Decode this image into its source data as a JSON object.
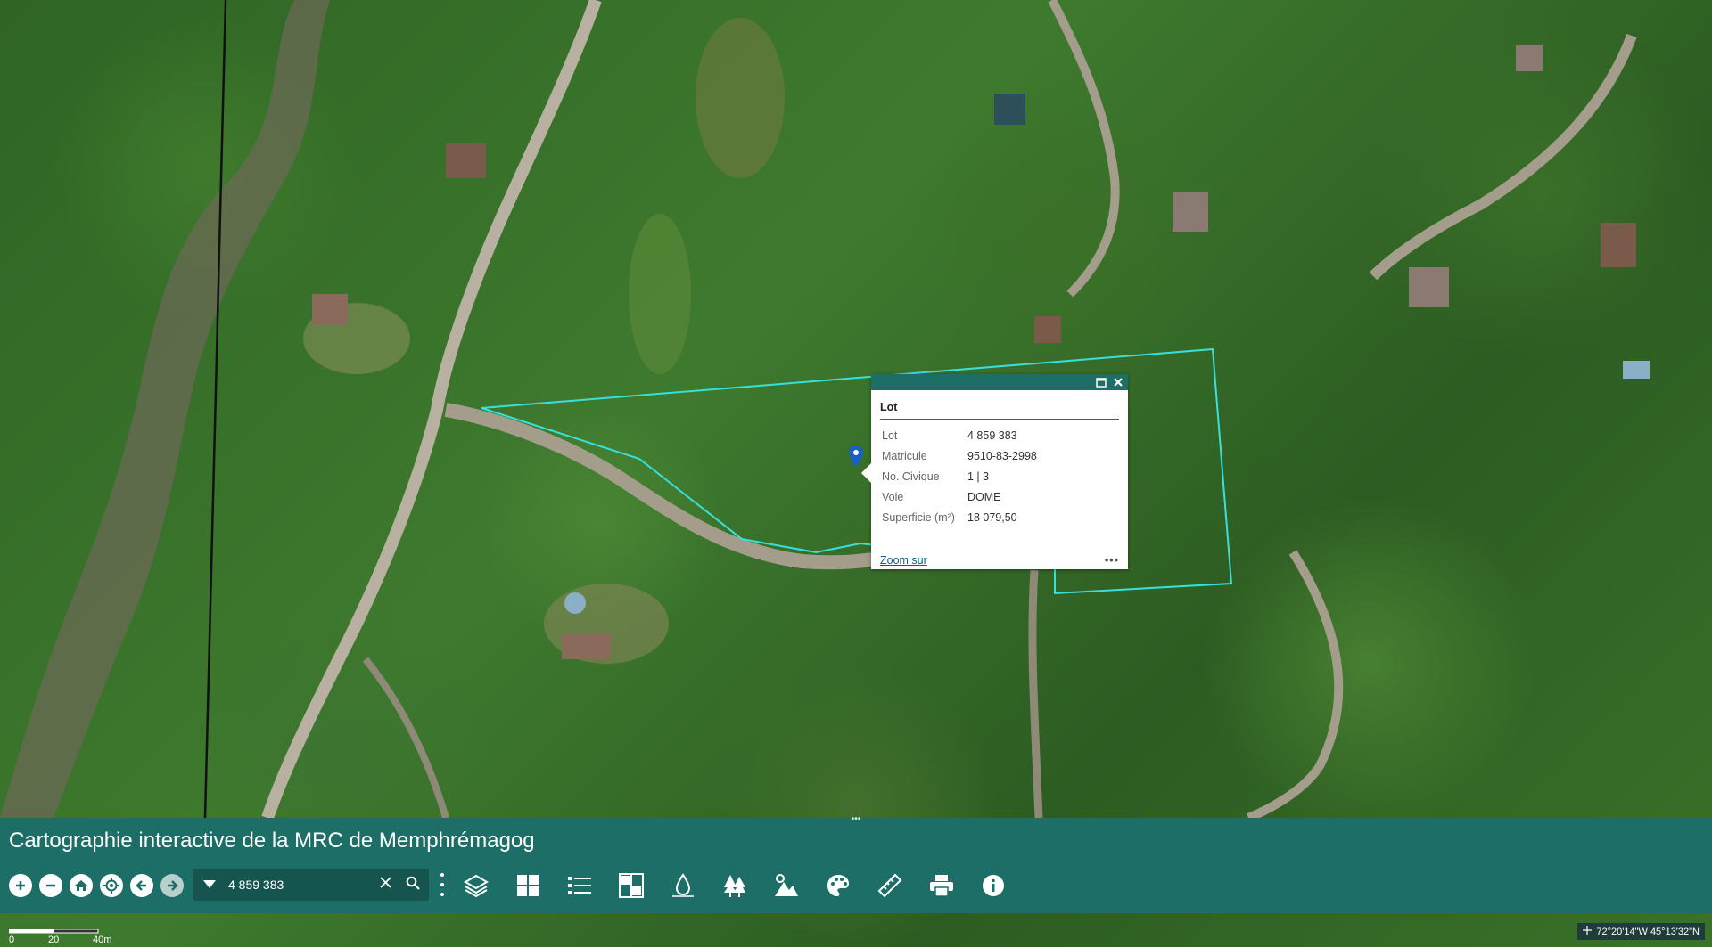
{
  "app": {
    "title": "Cartographie interactive de la MRC de Memphrémagog"
  },
  "popup": {
    "title": "Lot",
    "fields": [
      {
        "label": "Lot",
        "value": "4 859 383"
      },
      {
        "label": "Matricule",
        "value": "9510-83-2998"
      },
      {
        "label": "No. Civique",
        "value": "1 | 3"
      },
      {
        "label": "Voie",
        "value": "DOME"
      },
      {
        "label": "Superficie (m²)",
        "value": "18 079,50"
      }
    ],
    "zoom_link": "Zoom sur",
    "more": "•••",
    "close_icon": "close-icon",
    "maximize_icon": "maximize-icon"
  },
  "search": {
    "value": "4 859 383"
  },
  "nav_buttons": [
    "zoom-in-icon",
    "zoom-out-icon",
    "home-icon",
    "locate-icon",
    "back-icon",
    "forward-icon"
  ],
  "tools": [
    "layers-icon",
    "basemap-grid-icon",
    "legend-list-icon",
    "compare-icon",
    "water-drop-icon",
    "trees-icon",
    "landscape-icon",
    "palette-icon",
    "ruler-icon",
    "print-icon",
    "info-icon"
  ],
  "scale": {
    "labels": [
      "0",
      "20",
      "40m"
    ]
  },
  "coordinates": "72°20'14\"W 45°13'32\"N",
  "colors": {
    "bar": "#1e6e68",
    "parcel_outline": "#38e0dc",
    "popup_header": "#1e6e68"
  }
}
